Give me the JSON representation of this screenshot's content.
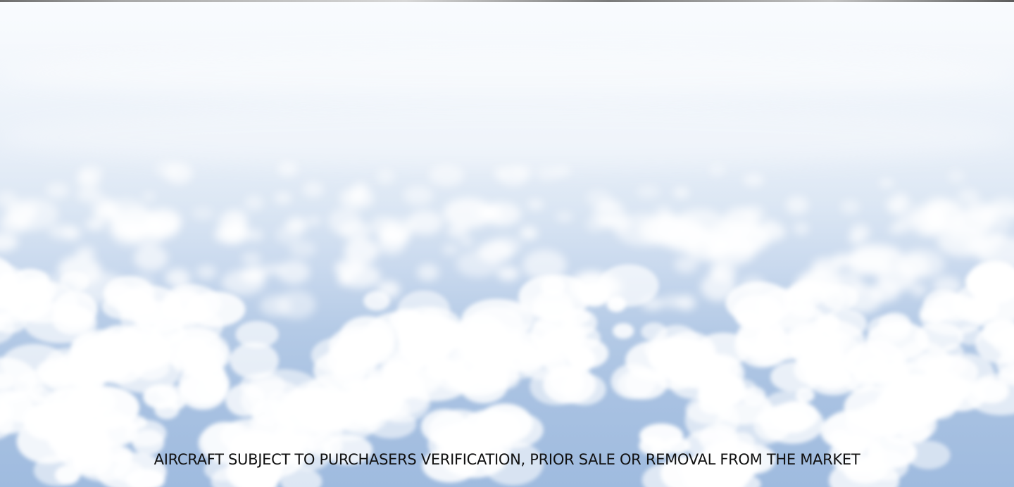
{
  "scene": {
    "description_colors": {
      "sky_top": "#f9fbfe",
      "sky_mid": "#dce7f4",
      "sky_bottom": "#9fbbdf",
      "cloud": "#ffffff"
    }
  },
  "disclaimer": {
    "text": "AIRCRAFT SUBJECT TO PURCHASERS VERIFICATION, PRIOR SALE OR REMOVAL FROM THE MARKET"
  }
}
